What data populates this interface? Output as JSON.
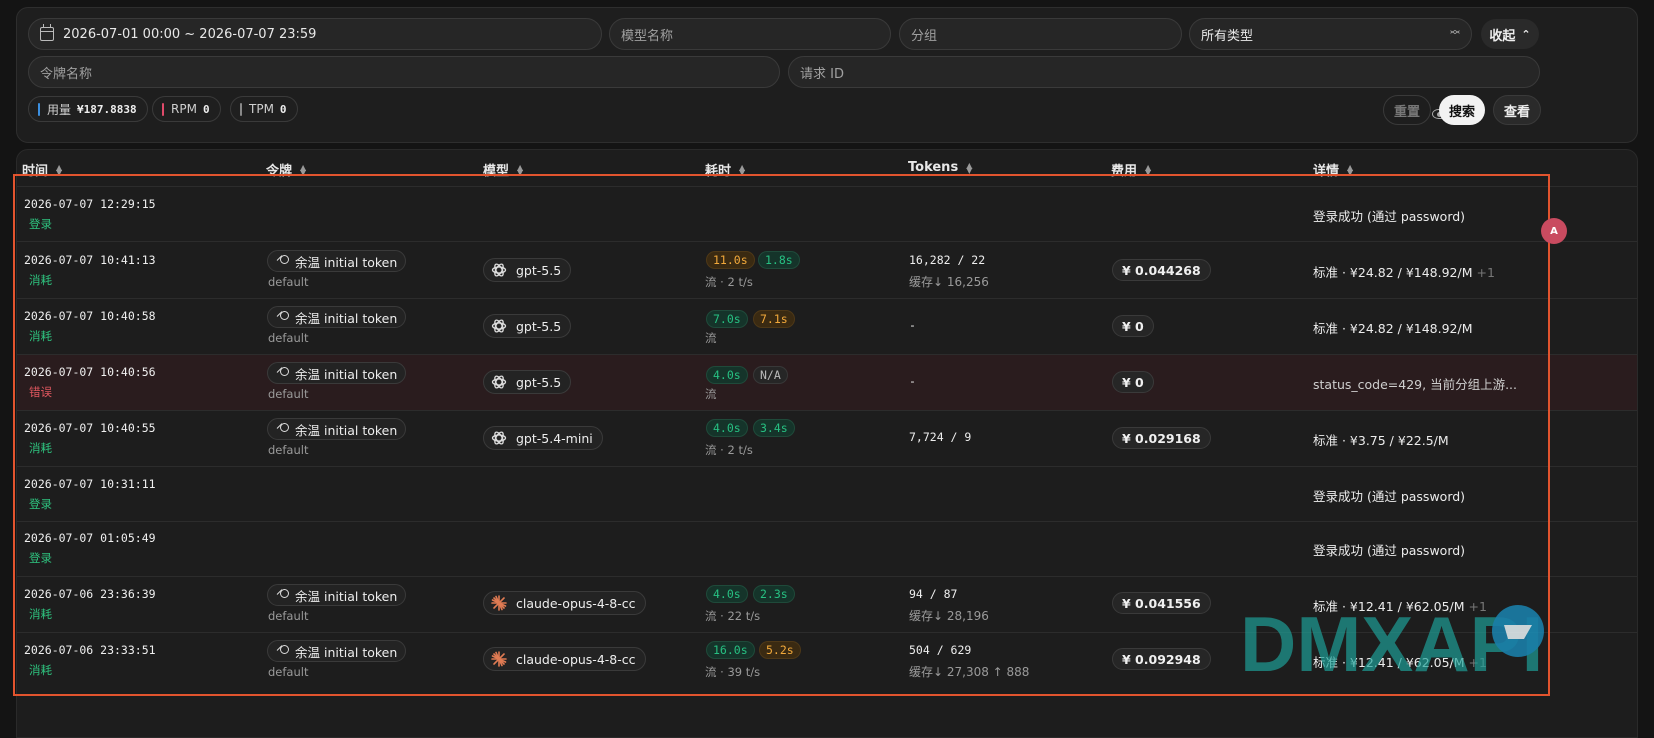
{
  "filters": {
    "date_range": "2026-07-01 00:00 ~ 2026-07-07 23:59",
    "model_placeholder": "模型名称",
    "group_placeholder": "分组",
    "type_select": "所有类型",
    "collapse_label": "收起",
    "token_placeholder": "令牌名称",
    "request_id_placeholder": "请求 ID"
  },
  "stats": {
    "usage_label": "用量",
    "usage_value": "¥187.8838",
    "rpm_label": "RPM",
    "rpm_value": "0",
    "tpm_label": "TPM",
    "tpm_value": "0"
  },
  "actions": {
    "reset": "重置",
    "search": "搜索",
    "view": "查看"
  },
  "columns": [
    "时间",
    "令牌",
    "模型",
    "耗时",
    "Tokens",
    "费用",
    "详情"
  ],
  "rows": [
    {
      "time": "2026-07-07 12:29:15",
      "type": "登录",
      "detail": "登录成功 (通过 password)"
    },
    {
      "time": "2026-07-07 10:41:13",
      "type": "消耗",
      "token": "余温 initial token",
      "group": "default",
      "model": "gpt-5.5",
      "t1": "11.0s",
      "t2": "1.8s",
      "stream": "流 · 2 t/s",
      "tokens": "16,282 / 22",
      "cache": "缓存↓ 16,256",
      "fee": "¥ 0.044268",
      "detail": "标准 · ¥24.82 / ¥148.92/M",
      "detail_extra": " +1"
    },
    {
      "time": "2026-07-07 10:40:58",
      "type": "消耗",
      "token": "余温 initial token",
      "group": "default",
      "model": "gpt-5.5",
      "t1": "7.0s",
      "t2": "7.1s",
      "stream": "流",
      "tokens": "-",
      "fee": "¥ 0",
      "detail": "标准 · ¥24.82 / ¥148.92/M"
    },
    {
      "time": "2026-07-07 10:40:56",
      "type": "错误",
      "token": "余温 initial token",
      "group": "default",
      "model": "gpt-5.5",
      "t1": "4.0s",
      "t2": "N/A",
      "stream": "流",
      "tokens": "-",
      "fee": "¥ 0",
      "detail": "status_code=429, 当前分组上游..."
    },
    {
      "time": "2026-07-07 10:40:55",
      "type": "消耗",
      "token": "余温 initial token",
      "group": "default",
      "model": "gpt-5.4-mini",
      "t1": "4.0s",
      "t2": "3.4s",
      "stream": "流 · 2 t/s",
      "tokens": "7,724 / 9",
      "fee": "¥ 0.029168",
      "detail": "标准 · ¥3.75 / ¥22.5/M"
    },
    {
      "time": "2026-07-07 10:31:11",
      "type": "登录",
      "detail": "登录成功 (通过 password)"
    },
    {
      "time": "2026-07-07 01:05:49",
      "type": "登录",
      "detail": "登录成功 (通过 password)"
    },
    {
      "time": "2026-07-06 23:36:39",
      "type": "消耗",
      "token": "余温 initial token",
      "group": "default",
      "model": "claude-opus-4-8-cc",
      "t1": "4.0s",
      "t2": "2.3s",
      "stream": "流 · 22 t/s",
      "tokens": "94 / 87",
      "cache": "缓存↓ 28,196",
      "fee": "¥ 0.041556",
      "detail": "标准 · ¥12.41 / ¥62.05/M",
      "detail_extra": " +1"
    },
    {
      "time": "2026-07-06 23:33:51",
      "type": "消耗",
      "token": "余温 initial token",
      "group": "default",
      "model": "claude-opus-4-8-cc",
      "t1": "16.0s",
      "t2": "5.2s",
      "stream": "流 · 39 t/s",
      "tokens": "504 / 629",
      "cache": "缓存↓ 27,308 ↑ 888",
      "fee": "¥ 0.092948",
      "detail": "标准 · ¥12.41 / ¥62.05/M",
      "detail_extra": " +1"
    }
  ],
  "watermark": "DMXAPI",
  "fab_label": "A",
  "colors": {
    "success": "#2ec27e",
    "error": "#e0575f",
    "fast": "#27c082",
    "slow": "#f2a93b",
    "highlight": "#e2542e"
  }
}
